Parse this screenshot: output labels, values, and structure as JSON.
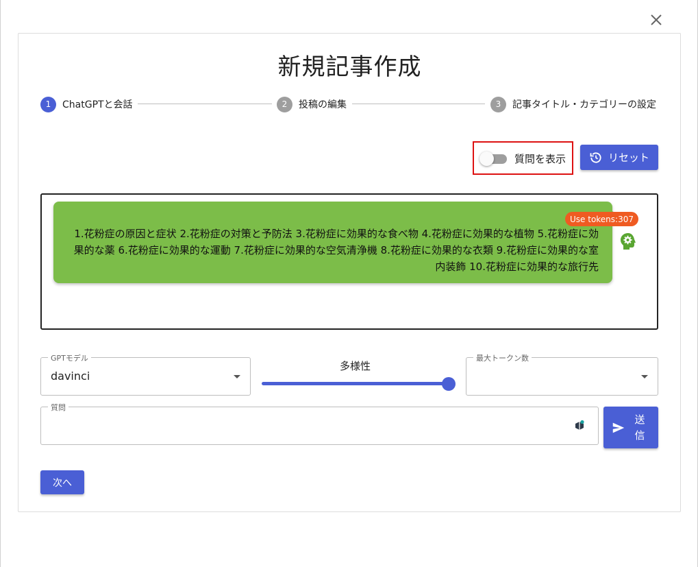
{
  "page": {
    "title": "新規記事作成"
  },
  "icons": {
    "close": "close-icon",
    "reset": "history-icon",
    "bot": "bot-settings-icon",
    "send": "send-icon",
    "extension": "extension-icon"
  },
  "colors": {
    "primary": "#4a5fd5",
    "bubble": "#7cbd49",
    "badge": "#ef5b22",
    "highlight": "#dd1111"
  },
  "stepper": {
    "steps": [
      {
        "number": "1",
        "label": "ChatGPTと会話",
        "active": true
      },
      {
        "number": "2",
        "label": "投稿の編集",
        "active": false
      },
      {
        "number": "3",
        "label": "記事タイトル・カテゴリーの設定",
        "active": false
      }
    ]
  },
  "toolbar": {
    "toggle_label": "質問を表示",
    "toggle_on": false,
    "reset_label": "リセット"
  },
  "chat": {
    "token_badge": "Use tokens:307",
    "message": "1.花粉症の原因と症状 2.花粉症の対策と予防法 3.花粉症に効果的な食べ物 4.花粉症に効果的な植物 5.花粉症に効果的な薬 6.花粉症に効果的な運動 7.花粉症に効果的な空気清浄機 8.花粉症に効果的な衣類 9.花粉症に効果的な室内装飾 10.花粉症に効果的な旅行先"
  },
  "controls": {
    "model_label": "GPTモデル",
    "model_value": "davinci",
    "diversity_label": "多様性",
    "diversity_level": 1.0,
    "max_tokens_label": "最大トークン数",
    "max_tokens_value": "",
    "question_label": "質問",
    "question_value": "",
    "send_label_1": "送",
    "send_label_2": "信"
  },
  "footer": {
    "next_label": "次へ"
  }
}
